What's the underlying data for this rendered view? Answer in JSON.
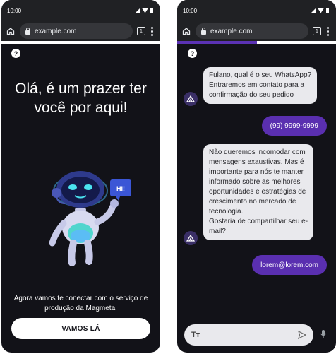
{
  "status_bar": {
    "time": "10:00"
  },
  "browser": {
    "url": "example.com",
    "tab_count": "1"
  },
  "help": {
    "label": "?"
  },
  "welcome_screen": {
    "title_line1": "Olá, é um prazer ter",
    "title_line2": "você por aqui!",
    "robot_sign": "HI!",
    "subtitle_line1": "Agora vamos te conectar com o serviço de",
    "subtitle_line2": "produção da Magmeta.",
    "cta_label": "VAMOS LÁ"
  },
  "chat_screen": {
    "progress_fraction": 0.5,
    "messages": [
      {
        "from": "bot",
        "lines": [
          "Fulano, qual é o seu WhatsApp?",
          "Entraremos em contato para a",
          "confirmação do seu pedido"
        ]
      },
      {
        "from": "user",
        "text": "(99) 9999-9999"
      },
      {
        "from": "bot",
        "lines": [
          "Não queremos incomodar com",
          "mensagens exaustivas. Mas é",
          "importante para nós te manter",
          "informado sobre as melhores",
          "oportunidades e estratégias de",
          "crescimento no mercado de",
          "tecnologia.",
          "Gostaria de compartilhar seu e-",
          "mail?"
        ]
      },
      {
        "from": "user",
        "text": "lorem@lorem.com"
      }
    ],
    "composer": {
      "format_label": "Tт"
    }
  },
  "colors": {
    "background": "#121218",
    "accent_purple": "#5a2fb0",
    "bot_bubble": "#e9e9ed",
    "browser_chrome": "#202124"
  },
  "icons": [
    "home-icon",
    "lock-icon",
    "tabs-icon",
    "menu-icon",
    "help-icon",
    "bot-avatar-icon",
    "send-icon",
    "mic-icon"
  ]
}
